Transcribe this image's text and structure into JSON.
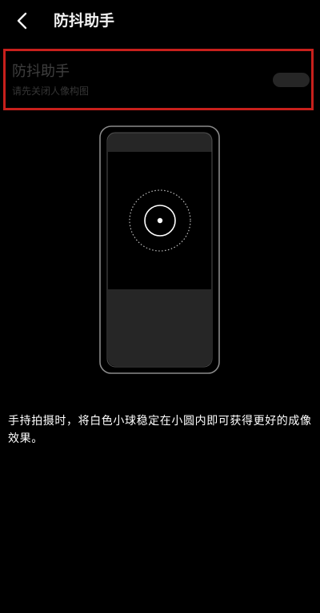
{
  "header": {
    "back_icon": "chevron-left-icon",
    "title": "防抖助手"
  },
  "setting": {
    "title": "防抖助手",
    "subtitle": "请先关闭人像构图",
    "toggle_state": "off",
    "highlight_color": "#c8201c"
  },
  "illustration": {
    "icon": "phone-stabilizer-illustration"
  },
  "description": "手持拍摄时，将白色小球稳定在小圆内即可获得更好的成像效果。"
}
